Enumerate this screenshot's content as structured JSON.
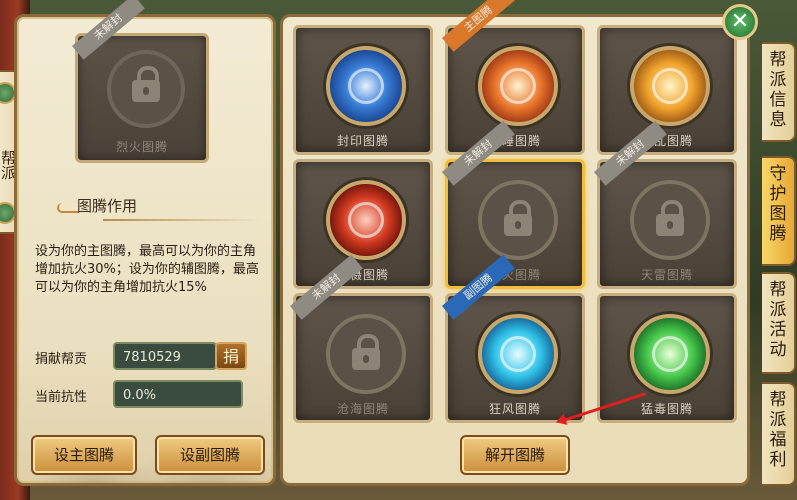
{
  "left_sidebar": {
    "vertical_text": "帮派"
  },
  "left_panel": {
    "current_slot": {
      "badge": "未解封",
      "name": "烈火图腾"
    },
    "section_title": "图腾作用",
    "description": "设为你的主图腾，最高可以为你的主角增加抗火30%；设为你的辅图腾，最高可以为你的主角增加抗火15%",
    "contribution_label": "捐献帮贡",
    "contribution_value": "7810529",
    "donate_button": "捐",
    "resistance_label": "当前抗性",
    "resistance_value": "0.0%",
    "set_main_button": "设主图腾",
    "set_sub_button": "设副图腾"
  },
  "totems": [
    {
      "name": "封印图腾",
      "badge": "",
      "state": "unlocked",
      "icon": "spiderweb-emblem-icon"
    },
    {
      "name": "昏睡图腾",
      "badge": "主图腾",
      "state": "unlocked",
      "icon": "spiral-sleep-emblem-icon"
    },
    {
      "name": "混乱图腾",
      "badge": "",
      "state": "unlocked",
      "icon": "knot-chaos-emblem-icon"
    },
    {
      "name": "震慑图腾",
      "badge": "",
      "state": "unlocked",
      "icon": "skull-fear-emblem-icon"
    },
    {
      "name": "烈火图腾",
      "badge": "未解封",
      "state": "locked",
      "icon": "lock-icon"
    },
    {
      "name": "天雷图腾",
      "badge": "未解封",
      "state": "locked",
      "icon": "lock-icon"
    },
    {
      "name": "沧海图腾",
      "badge": "未解封",
      "state": "locked",
      "icon": "lock-icon"
    },
    {
      "name": "狂风图腾",
      "badge": "副图腾",
      "state": "unlocked",
      "icon": "whirlwind-emblem-icon"
    },
    {
      "name": "猛毒图腾",
      "badge": "",
      "state": "unlocked",
      "icon": "poison-emblem-icon"
    }
  ],
  "unlock_button": "解开图腾",
  "close_button": "✕",
  "side_tabs": [
    {
      "label": "帮派信息"
    },
    {
      "label": "守护图腾"
    },
    {
      "label": "帮派活动"
    },
    {
      "label": "帮派福利"
    }
  ],
  "colors": {
    "accent": "#f1bd3c",
    "panel": "#f1e7cd",
    "slot": "#4a4136"
  }
}
